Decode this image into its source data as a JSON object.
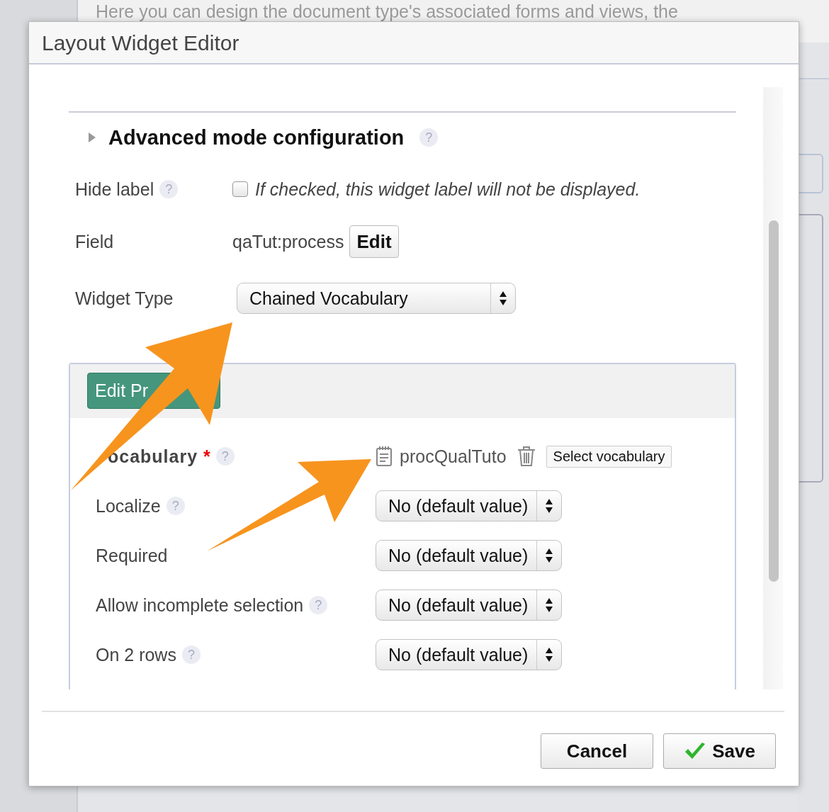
{
  "background_page": {
    "intro_text": "Here you can design the document type's associated forms and views, the"
  },
  "dialog": {
    "title": "Layout Widget Editor",
    "advanced_section": {
      "title": "Advanced mode configuration",
      "help": "?",
      "expanded": false
    },
    "fields": [
      {
        "kind": "checkbox",
        "label": "Hide label",
        "help": "?",
        "checked": false,
        "hint": "If checked, this widget label will not be displayed."
      },
      {
        "kind": "value",
        "label": "Field",
        "value": "qaTut:process",
        "button": "Edit"
      },
      {
        "kind": "select",
        "label": "Widget Type",
        "value": "Chained Vocabulary"
      }
    ],
    "properties_panel": {
      "button": "Edit Pr",
      "rows": [
        {
          "kind": "vocabulary",
          "label": "ocabulary",
          "required_mark": "*",
          "help": "?",
          "value": "procQualTuto",
          "button": "Select vocabulary"
        },
        {
          "kind": "select",
          "label": "Localize",
          "help": "?",
          "value": "No (default value)"
        },
        {
          "kind": "select",
          "label": "Required",
          "value": "No (default value)"
        },
        {
          "kind": "select",
          "label": "Allow incomplete selection",
          "help": "?",
          "value": "No (default value)"
        },
        {
          "kind": "select",
          "label": "On 2 rows",
          "help": "?",
          "value": "No (default value)"
        }
      ]
    },
    "buttons": [
      {
        "kind": "cancel",
        "label": "Cancel"
      },
      {
        "kind": "save",
        "label": "Save"
      }
    ]
  }
}
